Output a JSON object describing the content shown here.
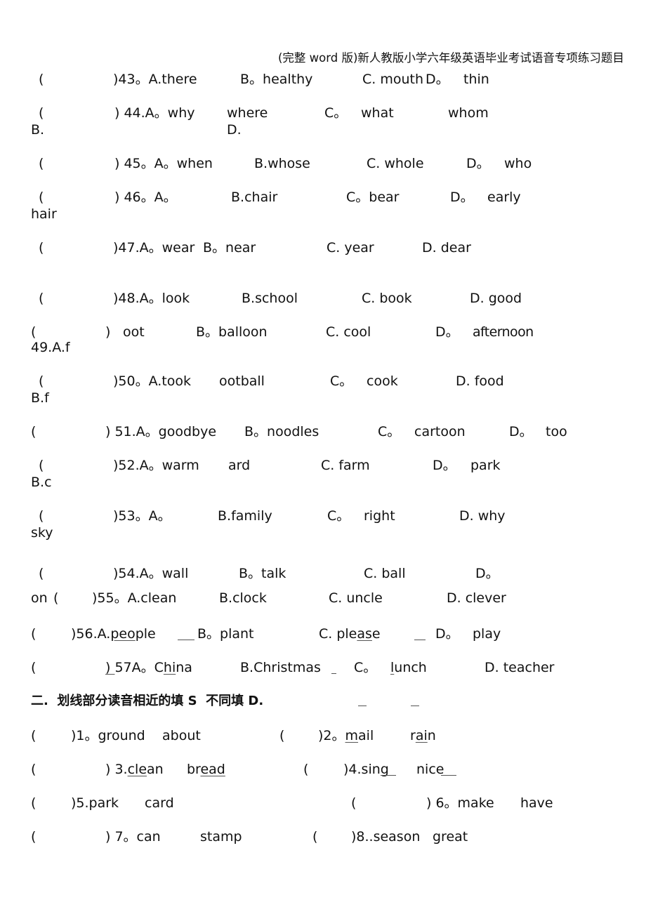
{
  "header": {
    "title": "(完整 word 版)新人教版小学六年级英语毕业考试语音专项练习题目"
  },
  "part1": {
    "q43": {
      "paren_open": "(",
      "num": ")43。A.there",
      "b": "B。healthy",
      "c": "C. mouth",
      "d": "D。",
      "d_word": "thin"
    },
    "q44": {
      "paren_open": "(",
      "num": ") 44.A。why",
      "b_word": "where",
      "b_label": "B.",
      "c": "C。",
      "c_word": "what",
      "d_word": "whom",
      "d_label": "D."
    },
    "q45": {
      "paren_open": "(",
      "num": ") 45。A。when",
      "b": "B.whose",
      "c": "C. whole",
      "d": "D。",
      "d_word": "who"
    },
    "q46": {
      "paren_open": "(",
      "num": ") 46。A。",
      "b": "B.chair",
      "c": "C。bear",
      "d": "D。",
      "d_word": "early",
      "a_word": "hair"
    },
    "q47": {
      "paren_open": "(",
      "num": ")47.A。wear",
      "b": "B。near",
      "c": "C. year",
      "d": "D. dear"
    },
    "q48": {
      "paren_open": "(",
      "num": ")48.A。look",
      "b": "B.school",
      "c": "C. book",
      "d": "D. good"
    },
    "q49": {
      "paren_open": "(",
      "paren_close": ")",
      "a_word": "oot",
      "num": "49.A.f",
      "b": "B。balloon",
      "c": "C. cool",
      "d": "D。",
      "d_word": "afternoon"
    },
    "q50": {
      "paren_open": "(",
      "num": ")50。A.took",
      "b_word": "ootball",
      "b_label": "B.f",
      "c": "C。",
      "c_word": "cook",
      "d": "D. food"
    },
    "q51": {
      "paren_open": "(",
      "num": ") 51.A。goodbye",
      "b": "B。noodles",
      "c": "C。",
      "c_word": "cartoon",
      "d": "D。",
      "d_word": "too"
    },
    "q52": {
      "paren_open": "(",
      "num": ")52.A。warm",
      "b_word": "ard",
      "b_label": "B.c",
      "c": "C. farm",
      "d": "D。",
      "d_word": "park"
    },
    "q53": {
      "paren_open": "(",
      "num": ")53。A。",
      "b": "B.family",
      "c": "C。",
      "c_word": "right",
      "d": "D. why",
      "a_word": "sky"
    },
    "q54": {
      "paren_open": "(",
      "num": ")54.A。wall",
      "b": "B。talk",
      "c": "C. ball",
      "d": "D。",
      "d_word": "on"
    },
    "q55": {
      "paren_open": "(",
      "num": ")55。A.clean",
      "b": "B.clock",
      "c": "C. uncle",
      "d": "D. clever"
    },
    "q56": {
      "paren_open": "(",
      "num": ")56.A.",
      "a_ul": "peo",
      "a_rest": "ple",
      "b": "B。plant",
      "c_pre": "C. ple",
      "c_ul": "as",
      "c_rest": "e",
      "d": "D。",
      "d_word": "play"
    },
    "q57": {
      "paren_open": "(",
      "num_ul": ") ",
      "num": "57A。C",
      "a_ul": "hi",
      "a_rest": "na",
      "b": "B.Christmas",
      "c": "C。",
      "c_ul": "l",
      "c_rest": "unch",
      "d": "D. teacher"
    }
  },
  "part2": {
    "heading": "二.  划线部分读音相近的填 S  不同填 D.",
    "items": [
      {
        "paren": "(",
        "num": ")1。ground",
        "word2": "about"
      },
      {
        "paren": "(",
        "num": ")2。",
        "w1_ul": "m",
        "w1_rest": "ail",
        "w2_ul": "ai",
        "w2_pre": "r",
        "w2_rest": "n"
      },
      {
        "paren": "(",
        "num": ") 3.",
        "w1_ul": "cle",
        "w1_rest": "an",
        "w2_pre": "br",
        "w2_ul": "ead"
      },
      {
        "paren": "(",
        "num": ")4.sing",
        "word2": "nice"
      },
      {
        "paren": "(",
        "num": ")5.park",
        "word2": "card"
      },
      {
        "paren": "(",
        "num": ") 6。make",
        "word2": "have"
      },
      {
        "paren": "(",
        "num": ") 7。can",
        "word2": "stamp"
      },
      {
        "paren": "(",
        "num": ")8..season",
        "word2": "great"
      }
    ]
  }
}
